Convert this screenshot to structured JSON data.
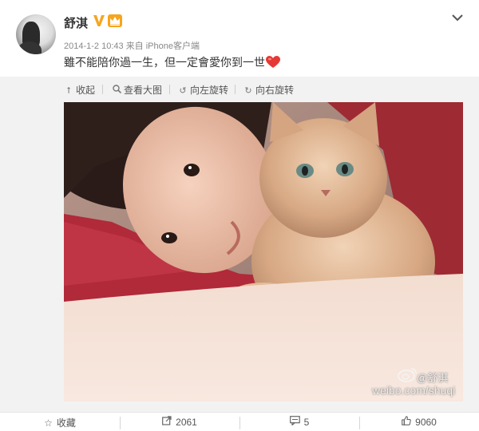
{
  "post": {
    "username": "舒淇",
    "timestamp": "2014-1-2 10:43",
    "source": "来自 iPhone客户端",
    "text": "雖不能陪你過一生，但一定會愛你到一世"
  },
  "toolbar": {
    "collapse_label": "收起",
    "view_large_label": "查看大图",
    "rotate_left_label": "向左旋转",
    "rotate_right_label": "向右旋转"
  },
  "photo": {
    "watermark_name": "@舒淇",
    "watermark_url": "weibo.com/shuqi"
  },
  "actions": {
    "favorite_label": "收藏",
    "repost_count": "2061",
    "comment_count": "5",
    "like_count": "9060"
  },
  "colors": {
    "verified_badge": "#f5a623",
    "heart": "#e53935",
    "text": "#333333",
    "meta": "#888888"
  }
}
